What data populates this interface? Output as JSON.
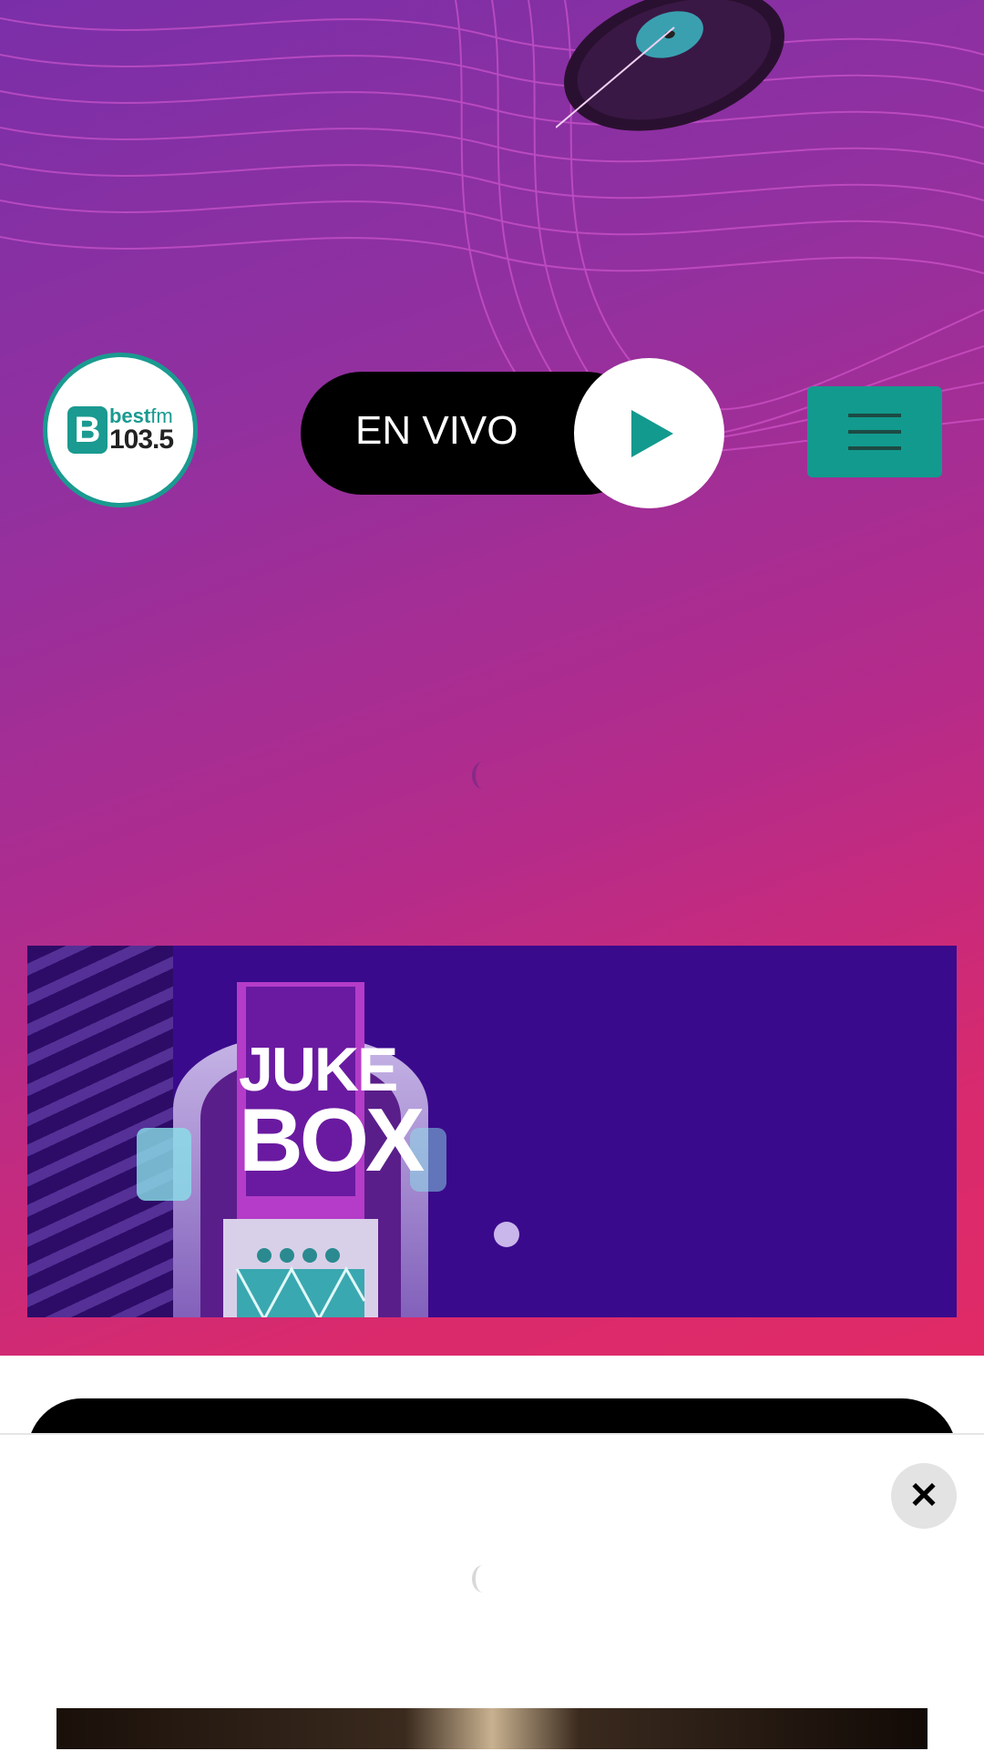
{
  "brand": {
    "logo_line1_a": "best",
    "logo_line1_b": "fm",
    "logo_line2": "103.5",
    "accent": "#1a9a90"
  },
  "player": {
    "live_label": "EN VIVO",
    "play_icon": "play-icon"
  },
  "menu": {
    "icon": "hamburger-menu-icon"
  },
  "banner": {
    "title_line1": "JUKE",
    "title_line2": "BOX",
    "slide_count": 1,
    "active_slide": 1
  },
  "sheet": {
    "close_icon": "close-icon",
    "close_glyph": "✕"
  }
}
